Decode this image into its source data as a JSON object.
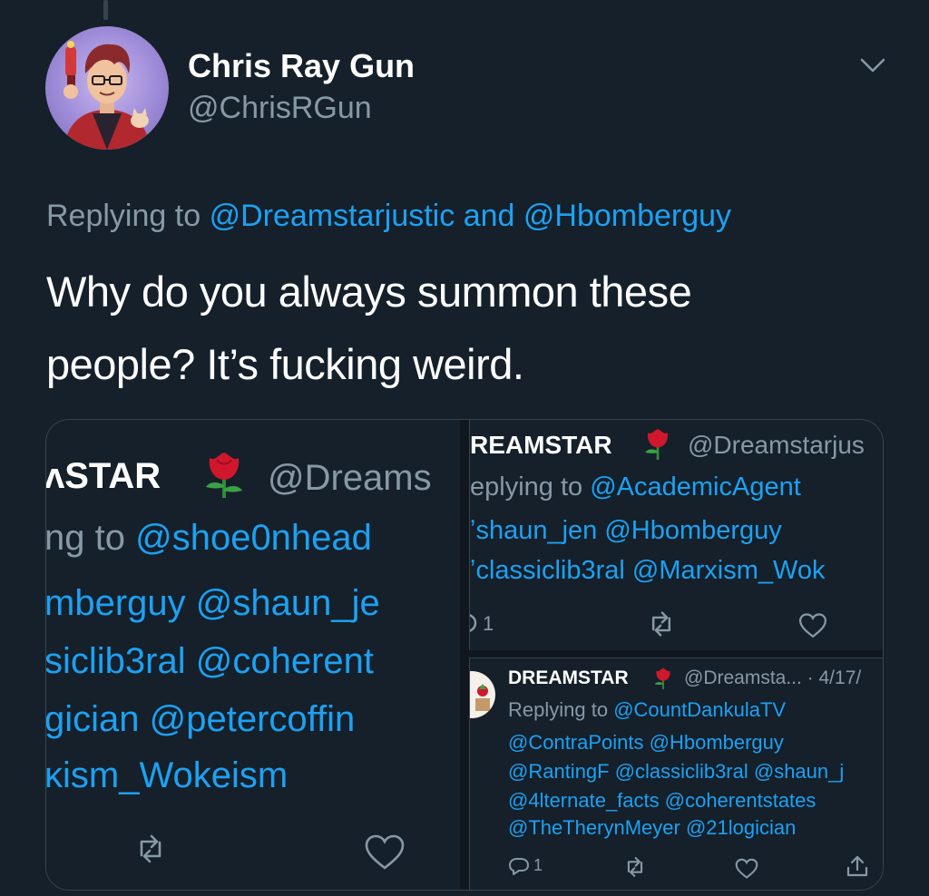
{
  "tweet": {
    "display_name": "Chris Ray Gun",
    "handle": "@ChrisRGun",
    "replying_prefix": "Replying to",
    "replying_user1": "@Dreamstarjustic",
    "replying_and": "and",
    "replying_user2": "@Hbomberguy",
    "text_line1": "Why do you always summon these",
    "text_line2": "people? It’s fucking weird."
  },
  "media": {
    "left_panel": {
      "name_fragment": "ʌSTAR",
      "handle_fragment": "@Dreams",
      "line1_gray": "ng to",
      "line1_blue": "@shoe0nhead",
      "line2": "mberguy @shaun_je",
      "line3": "siclib3ral @coherent",
      "line4": "gician @petercoffin",
      "line5": "κism_Wokeism"
    },
    "top_right_panel": {
      "name_fragment": "REAMSTAR",
      "handle_fragment": "@Dreamstarjus",
      "line1_gray": "eplying to",
      "line1_blue": "@AcademicAgent",
      "line2": "ʼshaun_jen  @Hbomberguy",
      "line3": "ʼclassiclib3ral @Marxism_Wok",
      "reply_count": "1"
    },
    "bottom_right_panel": {
      "name": "DREAMSTAR",
      "handle_time": "@Dreamsta... · 4/17/",
      "line1_gray": "Replying to",
      "line1_blue": "@CountDankulaTV",
      "line2": "@ContraPoints @Hbomberguy",
      "line3": "@RantingF @classiclib3ral @shaun_j",
      "line4": "@4lternate_facts @coherentstates",
      "line5": "@TheTherynMeyer @21logician",
      "reply_count": "1"
    }
  },
  "colors": {
    "background": "#15202b",
    "accent_blue": "#1da1f2",
    "secondary_gray": "#8899a6",
    "rose_red": "#d0172b"
  },
  "icons": [
    "chevron-down-icon",
    "rose-emoji",
    "reply-icon",
    "retweet-icon",
    "like-icon",
    "share-icon"
  ]
}
